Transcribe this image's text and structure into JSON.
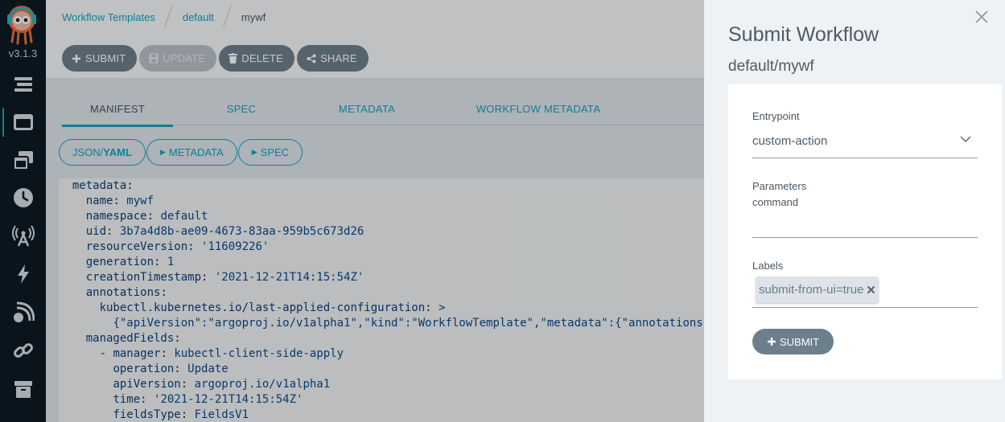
{
  "app": {
    "version": "v3.1.3"
  },
  "sidebar": {
    "items": [
      {
        "icon": "stream-icon"
      },
      {
        "icon": "workflow-templates-icon",
        "active": true
      },
      {
        "icon": "cluster-templates-icon"
      },
      {
        "icon": "cron-clock-icon"
      },
      {
        "icon": "event-sources-icon"
      },
      {
        "icon": "sensors-bolt-icon"
      },
      {
        "icon": "event-flow-icon"
      },
      {
        "icon": "link-icon"
      },
      {
        "icon": "archive-icon"
      }
    ]
  },
  "breadcrumb": {
    "items": [
      "Workflow Templates",
      "default",
      "mywf"
    ]
  },
  "actions": {
    "submit": "SUBMIT",
    "update": "UPDATE",
    "delete": "DELETE",
    "share": "SHARE"
  },
  "tabs": [
    "MANIFEST",
    "SPEC",
    "METADATA",
    "WORKFLOW METADATA"
  ],
  "toggles": {
    "json_prefix": "JSON/",
    "yaml": "YAML",
    "metadata": "METADATA",
    "spec": "SPEC"
  },
  "code_lines": [
    {
      "indent": "  ",
      "key": "metadata",
      "sep": ":",
      "value": ""
    },
    {
      "indent": "    ",
      "key": "name",
      "sep": ": ",
      "value": "mywf"
    },
    {
      "indent": "    ",
      "key": "namespace",
      "sep": ": ",
      "value": "default"
    },
    {
      "indent": "    ",
      "key": "uid",
      "sep": ": ",
      "value": "3b7a4d8b-ae09-4673-83aa-959b5c673d26"
    },
    {
      "indent": "    ",
      "key": "resourceVersion",
      "sep": ": ",
      "value": "'11609226'"
    },
    {
      "indent": "    ",
      "key": "generation",
      "sep": ": ",
      "value": "1"
    },
    {
      "indent": "    ",
      "key": "creationTimestamp",
      "sep": ": ",
      "value": "'2021-12-21T14:15:54Z'"
    },
    {
      "indent": "    ",
      "key": "annotations",
      "sep": ":",
      "value": ""
    },
    {
      "indent": "      ",
      "key": "kubectl.kubernetes.io/last-applied-configuration",
      "sep": ": ",
      "value": ">"
    },
    {
      "indent": "        ",
      "key": "",
      "sep": "",
      "value": "{\"apiVersion\":\"argoproj.io/v1alpha1\",\"kind\":\"WorkflowTemplate\",\"metadata\":{\"annotations\":{},\"name\":\"mywf\",\"namespace\":\"default\"}}"
    },
    {
      "indent": "    ",
      "key": "managedFields",
      "sep": ":",
      "value": ""
    },
    {
      "indent": "      - ",
      "key": "manager",
      "sep": ": ",
      "value": "kubectl-client-side-apply"
    },
    {
      "indent": "        ",
      "key": "operation",
      "sep": ": ",
      "value": "Update"
    },
    {
      "indent": "        ",
      "key": "apiVersion",
      "sep": ": ",
      "value": "argoproj.io/v1alpha1"
    },
    {
      "indent": "        ",
      "key": "time",
      "sep": ": ",
      "value": "'2021-12-21T14:15:54Z'"
    },
    {
      "indent": "        ",
      "key": "fieldsType",
      "sep": ": ",
      "value": "FieldsV1"
    }
  ],
  "panel": {
    "title": "Submit Workflow",
    "subtitle": "default/mywf",
    "entrypoint_label": "Entrypoint",
    "entrypoint_value": "custom-action",
    "parameters_label": "Parameters",
    "param_name": "command",
    "param_value": "",
    "labels_label": "Labels",
    "labels": [
      "submit-from-ui=true"
    ],
    "submit": "SUBMIT"
  },
  "colors": {
    "accent": "#19a0c2",
    "sidebar": "#0e1a25",
    "button": "#6d7f8b"
  }
}
